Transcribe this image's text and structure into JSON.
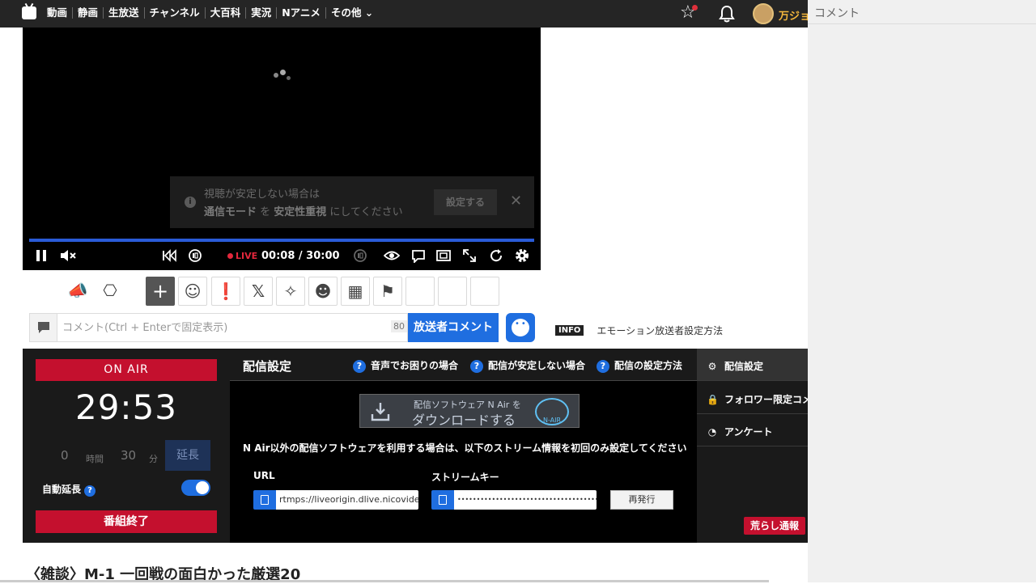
{
  "nav": {
    "items": [
      "動画",
      "静画",
      "生放送",
      "チャンネル",
      "大百科",
      "実況",
      "Nアニメ",
      "その他 ⌄"
    ],
    "username": "万ジョ"
  },
  "comment_panel": {
    "title": "コメント"
  },
  "player": {
    "notice_line1": "視聴が安定しない場合は",
    "notice_line2_a": "通信モード",
    "notice_line2_b": " を ",
    "notice_line2_c": "安定性重視",
    "notice_line2_d": " にしてください",
    "notice_button": "設定する",
    "notice_close": "✕",
    "live_badge": "LIVE",
    "time": "00:08 / 30:00"
  },
  "comment_input": {
    "placeholder": "コメント(Ctrl + Enterで固定表示)",
    "count": "80",
    "broadcaster_button": "放送者コメント"
  },
  "info": {
    "tag": "INFO",
    "text": "エモーション放送者設定方法"
  },
  "broadcast": {
    "on_air": "ON AIR",
    "timer": "29:53",
    "ext_hours": "0",
    "ext_hours_label": "時間",
    "ext_minutes": "30",
    "ext_minutes_label": "分",
    "extend_button": "延長",
    "auto_extend_label": "自動延長",
    "end_button": "番組終了",
    "settings_title": "配信設定",
    "help_audio": "音声でお困りの場合",
    "help_unstable": "配信が安定しない場合",
    "help_howto": "配信の設定方法",
    "nair_small": "配信ソフトウェア N Air を",
    "nair_big": "ダウンロードする",
    "nair_logo": "N-AIR",
    "stream_note": "N Air以外の配信ソフトウェアを利用する場合は、以下のストリーム情報を初回のみ設定してください",
    "url_label": "URL",
    "url_value": "rtmps://liveorigin.dlive.nicovideo.jp",
    "key_label": "ストリームキー",
    "key_value": "••••••••••••••••••••••••••••••••••••••••••••••••••••",
    "reissue_button": "再発行",
    "menu": [
      "配信設定",
      "フォロワー限定コメント",
      "アンケート"
    ],
    "troll_button": "荒らし通報"
  },
  "program_title": "〈雑談〉M-1 一回戦の面白かった厳選20"
}
